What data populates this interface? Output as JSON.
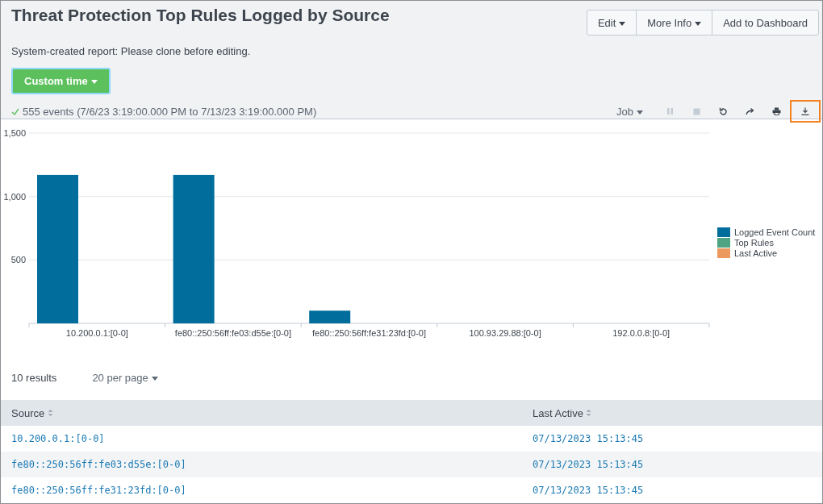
{
  "title": "Threat Protection Top Rules Logged by Source",
  "subtitle": "System-created report: Please clone before editing.",
  "header_buttons": [
    {
      "label": "Edit",
      "caret": true
    },
    {
      "label": "More Info",
      "caret": true
    },
    {
      "label": "Add to Dashboard",
      "caret": false
    }
  ],
  "time_picker": {
    "label": "Custom time"
  },
  "job_status": "555 events (7/6/23 3:19:00.000 PM to 7/13/23 3:19:00.000 PM)",
  "job_menu": {
    "label": "Job"
  },
  "job_controls": [
    {
      "kind": "pause",
      "disabled": true,
      "highlighted": false
    },
    {
      "kind": "stop",
      "disabled": true,
      "highlighted": false
    },
    {
      "kind": "refresh",
      "disabled": false,
      "highlighted": false
    },
    {
      "kind": "share",
      "disabled": false,
      "highlighted": false
    },
    {
      "kind": "print",
      "disabled": false,
      "highlighted": false
    },
    {
      "kind": "download",
      "disabled": false,
      "highlighted": true
    }
  ],
  "chart": {
    "chart_data": {
      "type": "bar",
      "categories": [
        "10.200.0.1:[0-0]",
        "fe80::250:56ff:fe03:d55e:[0-0]",
        "fe80::250:56ff:fe31:23fd:[0-0]",
        "100.93.29.88:[0-0]",
        "192.0.0.8:[0-0]"
      ],
      "series": [
        {
          "name": "Logged Event Count",
          "color": "#006d9c",
          "values": [
            1170,
            1170,
            100,
            0,
            0
          ]
        },
        {
          "name": "Top Rules",
          "color": "#4fa484",
          "values": [
            null,
            null,
            null,
            null,
            null
          ]
        },
        {
          "name": "Last Active",
          "color": "#ec9960",
          "values": [
            null,
            null,
            null,
            null,
            null
          ]
        }
      ],
      "ylim": [
        0,
        1500
      ],
      "yticks": [
        {
          "value": 500,
          "label": "500"
        },
        {
          "value": 1000,
          "label": "1,000"
        },
        {
          "value": 1500,
          "label": "1,500"
        }
      ]
    }
  },
  "results_count": "10 results",
  "per_page": {
    "label": "20 per page"
  },
  "table": {
    "columns": [
      "Source",
      "Last Active"
    ],
    "rows": [
      [
        "10.200.0.1:[0-0]",
        "07/13/2023 15:13:45"
      ],
      [
        "fe80::250:56ff:fe03:d55e:[0-0]",
        "07/13/2023 15:13:45"
      ],
      [
        "fe80::250:56ff:fe31:23fd:[0-0]",
        "07/13/2023 15:13:45"
      ]
    ]
  }
}
